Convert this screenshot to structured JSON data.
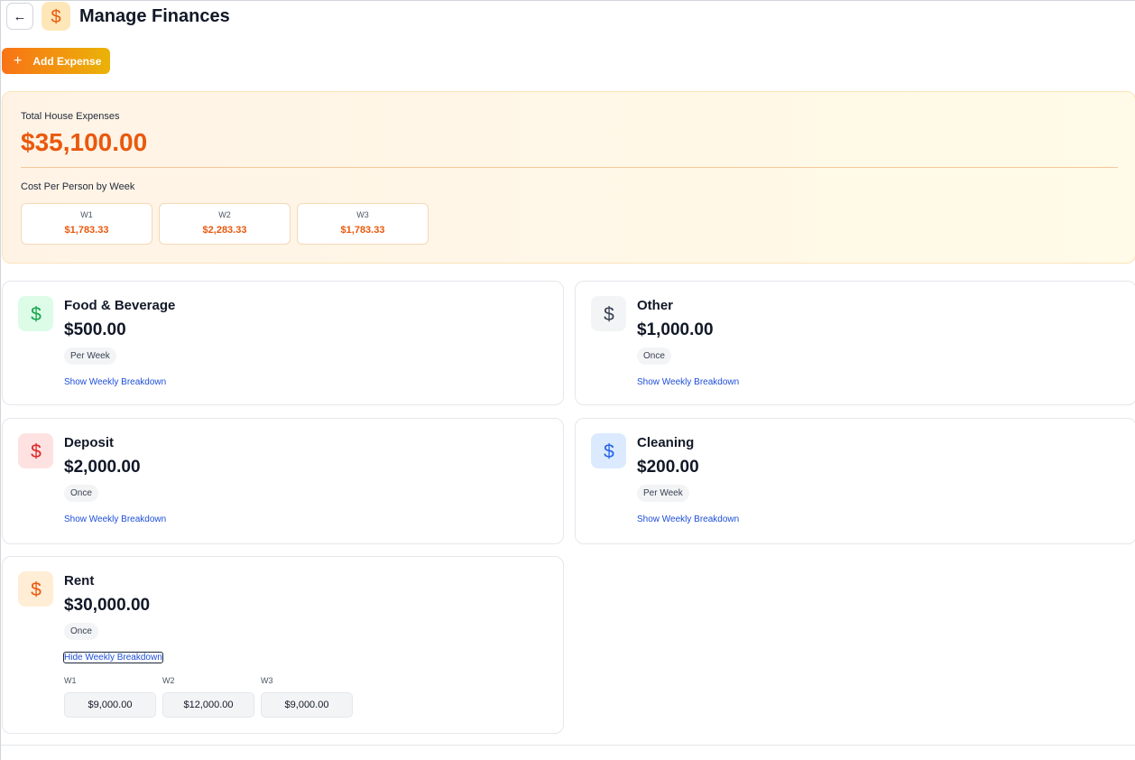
{
  "header": {
    "back_icon": "arrow-left-icon",
    "title": "Manage Finances",
    "logo_icon": "dollar-icon",
    "logo_color": "#ea580c"
  },
  "toolbar": {
    "add_label": "Add Expense"
  },
  "summary": {
    "total_label": "Total House Expenses",
    "total_value": "$35,100.00",
    "week_label": "Cost Per Person by Week",
    "weeks": [
      {
        "label": "W1",
        "value": "$1,783.33"
      },
      {
        "label": "W2",
        "value": "$2,283.33"
      },
      {
        "label": "W3",
        "value": "$1,783.33"
      }
    ]
  },
  "expenses": [
    {
      "name": "Food & Beverage",
      "amount": "$500.00",
      "frequency": "Per Week",
      "link": "Show Weekly Breakdown",
      "icon_bg": "#dcfce7",
      "icon_color": "#16a34a"
    },
    {
      "name": "Other",
      "amount": "$1,000.00",
      "frequency": "Once",
      "link": "Show Weekly Breakdown",
      "icon_bg": "#f3f4f6",
      "icon_color": "#374151"
    },
    {
      "name": "Deposit",
      "amount": "$2,000.00",
      "frequency": "Once",
      "link": "Show Weekly Breakdown",
      "icon_bg": "#fee2e2",
      "icon_color": "#dc2626"
    },
    {
      "name": "Cleaning",
      "amount": "$200.00",
      "frequency": "Per Week",
      "link": "Show Weekly Breakdown",
      "icon_bg": "#dbeafe",
      "icon_color": "#2563eb"
    },
    {
      "name": "Rent",
      "amount": "$30,000.00",
      "frequency": "Once",
      "link": "Hide Weekly Breakdown",
      "icon_bg": "#ffedd5",
      "icon_color": "#ea580c",
      "breakdown": [
        {
          "label": "W1",
          "value": "$9,000.00"
        },
        {
          "label": "W2",
          "value": "$12,000.00"
        },
        {
          "label": "W3",
          "value": "$9,000.00"
        }
      ]
    }
  ]
}
